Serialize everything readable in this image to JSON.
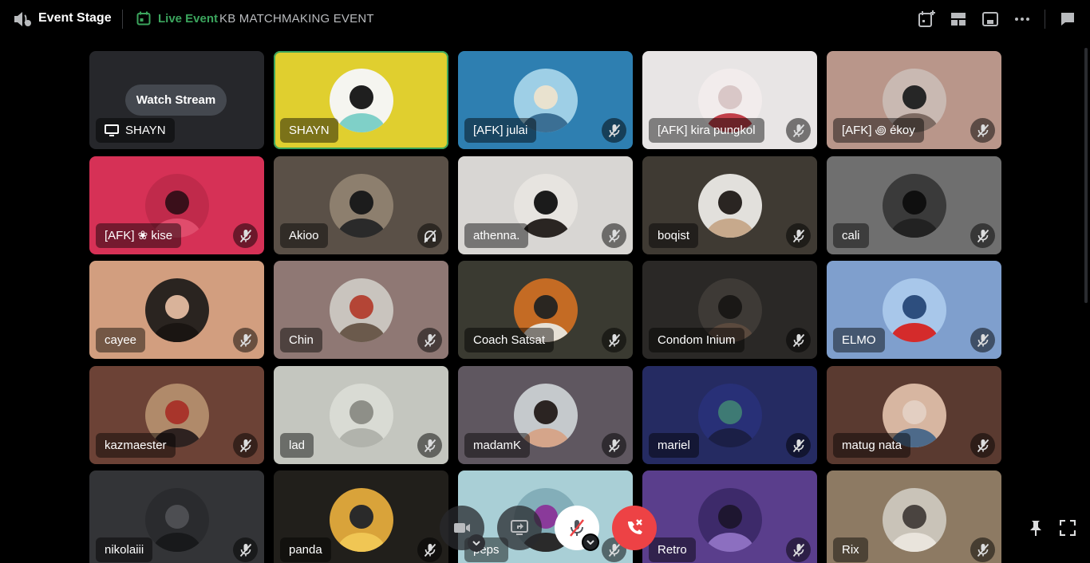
{
  "header": {
    "title": "Event Stage",
    "live_label": "Live Event",
    "event_name": "KB MATCHMAKING EVENT",
    "icons": [
      "speaker-icon",
      "calendar-icon",
      "add-event-icon",
      "layout-icon",
      "popout-icon",
      "more-icon",
      "chat-icon"
    ]
  },
  "stream": {
    "watch_label": "Watch Stream",
    "streamer": "SHAYN"
  },
  "participants": [
    {
      "name": "SHAYN",
      "bg": "#e0cf2f",
      "status": "speaking",
      "av": [
        "#f5f5f0",
        "#1f1f1f",
        "#7fd0c8"
      ]
    },
    {
      "name": "[AFK] julai",
      "bg": "#2e7fb1",
      "status": "muted",
      "av": [
        "#9ecfe6",
        "#e9e2cf",
        "#3b6f94"
      ]
    },
    {
      "name": "[AFK] kira pungkol",
      "bg": "#e8e5e5",
      "status": "muted",
      "av": [
        "#f2ecec",
        "#d9c7c7",
        "#c2404a"
      ]
    },
    {
      "name": "[AFK] ꩜ ékoy",
      "bg": "#b9968a",
      "status": "muted",
      "av": [
        "#c9b9b2",
        "#262626",
        "#7d6a62"
      ]
    },
    {
      "name": "[AFK] ❀ kise",
      "bg": "#d63156",
      "status": "muted",
      "av": [
        "#c02a4b",
        "#3a0f1a",
        "#e04c6c"
      ]
    },
    {
      "name": "Akioo",
      "bg": "#5a5047",
      "status": "deafened",
      "av": [
        "#8d7f6e",
        "#1c1c1c",
        "#2a2a2a"
      ]
    },
    {
      "name": "athenna.",
      "bg": "#d8d6d3",
      "status": "muted",
      "av": [
        "#e7e4e0",
        "#1b1b1b",
        "#2a2522"
      ]
    },
    {
      "name": "boqist",
      "bg": "#3f3a33",
      "status": "muted",
      "av": [
        "#e2e0dc",
        "#2a2522",
        "#c7a98c"
      ]
    },
    {
      "name": "cali",
      "bg": "#6f6f6f",
      "status": "muted",
      "av": [
        "#3a3a3a",
        "#0f0f0f",
        "#222222"
      ]
    },
    {
      "name": "cayee",
      "bg": "#d29e7f",
      "status": "muted",
      "av": [
        "#2a2420",
        "#d9b39a",
        "#1a1512"
      ]
    },
    {
      "name": "Chin",
      "bg": "#8f7874",
      "status": "muted",
      "av": [
        "#c9c4be",
        "#b44536",
        "#6b5a4c"
      ]
    },
    {
      "name": "Coach Satsat",
      "bg": "#3a3a31",
      "status": "muted",
      "av": [
        "#c46b24",
        "#2a2621",
        "#e7e1d6"
      ]
    },
    {
      "name": "Condom Inium",
      "bg": "#2a2826",
      "status": "muted",
      "av": [
        "#3e3a36",
        "#1a1816",
        "#5b4a3e"
      ]
    },
    {
      "name": "ELMO",
      "bg": "#7f9fcd",
      "status": "muted",
      "av": [
        "#a8c7ea",
        "#2d4e7e",
        "#d42b2b"
      ]
    },
    {
      "name": "kazmaester",
      "bg": "#6c4236",
      "status": "muted",
      "av": [
        "#b08a6a",
        "#a8352b",
        "#2e2220"
      ]
    },
    {
      "name": "lad",
      "bg": "#c4c6bf",
      "status": "muted",
      "av": [
        "#d9dbd4",
        "#8e8f88",
        "#b1b3ac"
      ]
    },
    {
      "name": "madamK",
      "bg": "#5f5760",
      "status": "muted",
      "av": [
        "#c5c9cc",
        "#2b2422",
        "#d5a58a"
      ]
    },
    {
      "name": "mariel",
      "bg": "#252b62",
      "status": "muted",
      "av": [
        "#283077",
        "#3e7a74",
        "#1b1f46"
      ]
    },
    {
      "name": "matug nata",
      "bg": "#5a3a30",
      "status": "muted",
      "av": [
        "#d7b6a1",
        "#e3cfc2",
        "#4d6a8a"
      ]
    },
    {
      "name": "nikolaiii",
      "bg": "#333437",
      "status": "muted",
      "av": [
        "#2a2b2e",
        "#4d4e52",
        "#18191b"
      ]
    },
    {
      "name": "panda",
      "bg": "#211f1b",
      "status": "muted",
      "av": [
        "#d9a33a",
        "#2a2a2a",
        "#f0c654"
      ]
    },
    {
      "name": "peps",
      "bg": "#a9cfd6",
      "status": "muted",
      "av": [
        "#83aeb9",
        "#8a3a9a",
        "#2a2a2a"
      ]
    },
    {
      "name": "Retro",
      "bg": "#5a3e8c",
      "status": "muted",
      "av": [
        "#3d2a6a",
        "#1e1630",
        "#8c6fc0"
      ]
    },
    {
      "name": "Rix",
      "bg": "#8d7a63",
      "status": "muted",
      "av": [
        "#c9c3b8",
        "#4a4440",
        "#e9e4dc"
      ]
    }
  ],
  "controls": {
    "icons": [
      "camera-icon",
      "screen-share-icon",
      "microphone-muted-icon",
      "leave-call-icon",
      "chevron-down-icon",
      "pin-icon",
      "fullscreen-icon"
    ],
    "mic_bg": "#ffffff",
    "leave_bg": "#ed4245",
    "accent": "#3ba55d"
  }
}
